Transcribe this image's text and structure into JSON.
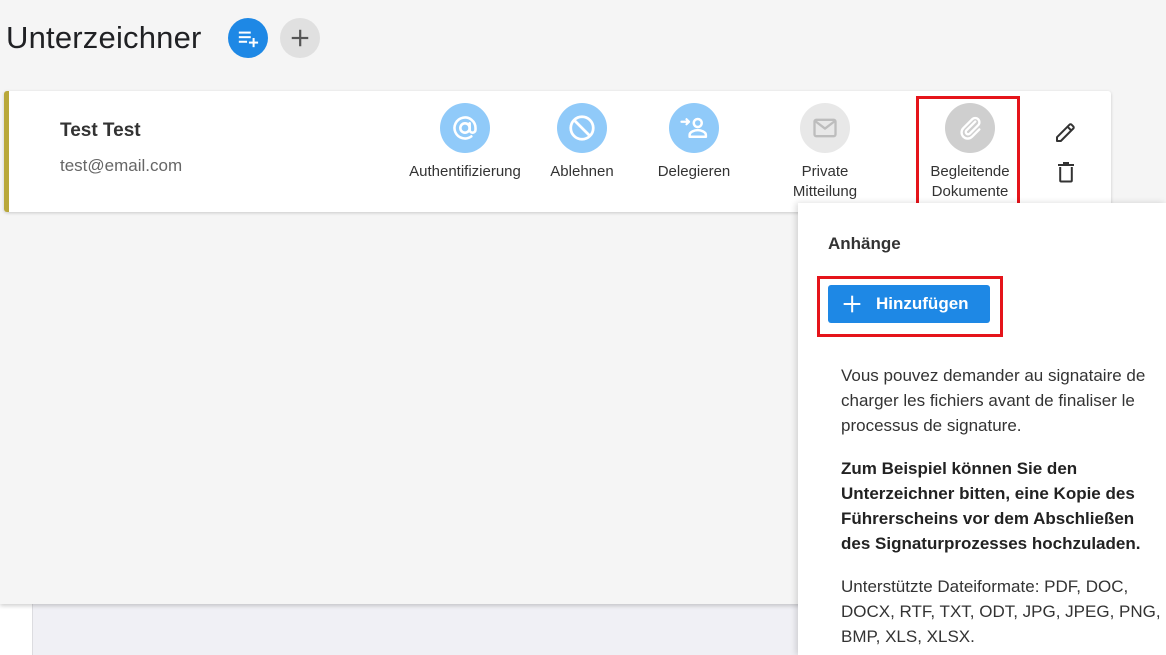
{
  "header": {
    "title": "Unterzeichner",
    "add_list_icon": "playlist-add-icon",
    "add_icon": "plus-icon"
  },
  "signer": {
    "name": "Test Test",
    "email": "test@email.com",
    "accent_color": "#b9a83a",
    "actions": [
      {
        "label": "Authentifizierung",
        "icon": "at-sign-icon"
      },
      {
        "label": "Ablehnen",
        "icon": "block-icon"
      },
      {
        "label": "Delegieren",
        "icon": "delegate-user-icon"
      },
      {
        "label_line1": "Private",
        "label_line2": "Mitteilung",
        "icon": "mail-icon"
      },
      {
        "label_line1": "Begleitende",
        "label_line2": "Dokumente",
        "icon": "paperclip-icon"
      }
    ],
    "edit_icon": "pencil-icon",
    "delete_icon": "trash-icon"
  },
  "panel": {
    "title": "Anhänge",
    "add_button_label": "Hinzufügen",
    "text1": "Vous pouvez demander au signataire de charger les fichiers avant de finaliser le processus de signature.",
    "text2": "Zum Beispiel können Sie den Unterzeichner bitten, eine Kopie des Führerscheins vor dem Abschließen des Signaturprozesses hochzuladen.",
    "text3": "Unterstützte Dateiformate: PDF, DOC, DOCX, RTF, TXT, ODT, JPG, JPEG, PNG, BMP, XLS, XLSX."
  },
  "colors": {
    "primary": "#1e88e5",
    "icon_circle_blue": "#90caf9",
    "highlight_red": "#e5141a"
  }
}
